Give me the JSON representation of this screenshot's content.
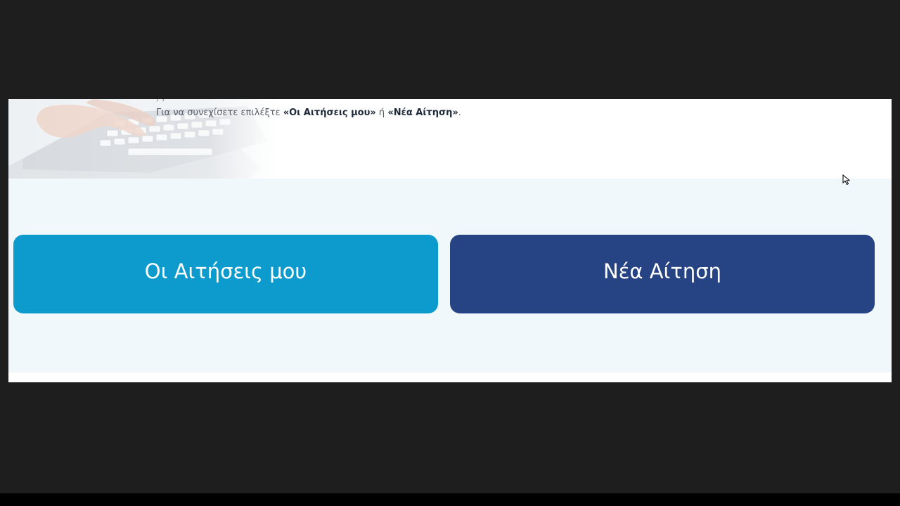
{
  "hero": {
    "intro_prefix": "Για να συνεχίσετε επιλέξτε ",
    "intro_opt1": "«Οι Αιτήσεις μου»",
    "intro_mid": " ή ",
    "intro_opt2": "«Νέα Αίτηση»",
    "intro_suffix": "."
  },
  "actions": {
    "my_requests_label": "Οι Αιτήσεις μου",
    "new_request_label": "Νέα Αίτηση"
  },
  "colors": {
    "my_requests_bg": "#0d9bce",
    "new_request_bg": "#264384",
    "panel_bg": "#f0f8fb"
  }
}
